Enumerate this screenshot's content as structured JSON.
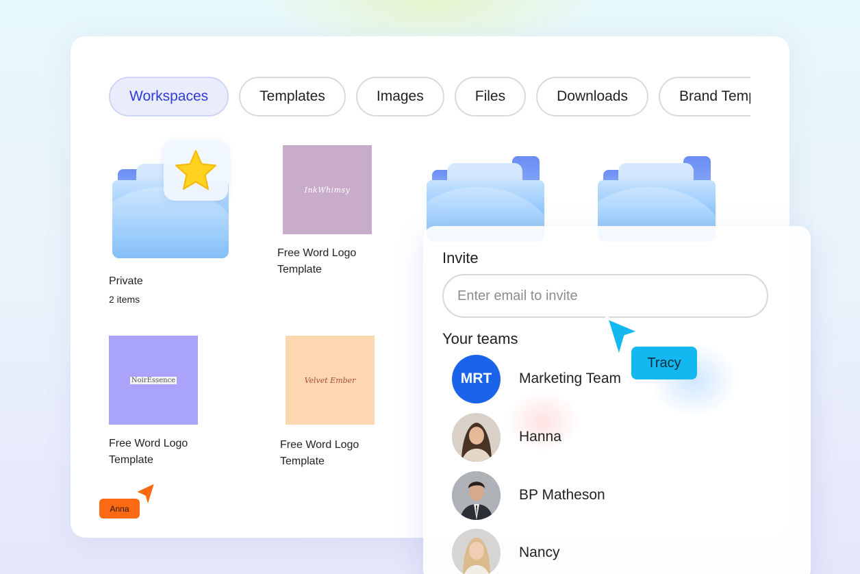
{
  "tabs": [
    {
      "label": "Workspaces",
      "active": true
    },
    {
      "label": "Templates",
      "active": false
    },
    {
      "label": "Images",
      "active": false
    },
    {
      "label": "Files",
      "active": false
    },
    {
      "label": "Downloads",
      "active": false
    },
    {
      "label": "Brand Templates",
      "active": false
    }
  ],
  "items": {
    "private_folder": {
      "name": "Private",
      "count": "2 items"
    },
    "template1": {
      "name_line1": "Free Word Logo",
      "name_line2": "Template",
      "thumb_text": "InkWhimsy",
      "thumb_color": "#c9acc9"
    },
    "template2": {
      "name_line1": "Free Word Logo",
      "name_line2": "Template",
      "thumb_text": "NoirEssence",
      "thumb_color": "#a9a4fa"
    },
    "template3": {
      "name_line1": "Free Word Logo",
      "name_line2": "Template",
      "thumb_text": "Velvet Ember",
      "thumb_color": "#fcd7b0"
    }
  },
  "invite": {
    "title": "Invite",
    "input_placeholder": "Enter email to invite",
    "teams_title": "Your teams",
    "teams": [
      {
        "initials": "MRT",
        "name": "Marketing Team",
        "avatar_color": "#1b63e9"
      },
      {
        "name": "Hanna"
      },
      {
        "name": "BP Matheson"
      },
      {
        "name": "Nancy"
      }
    ]
  },
  "cursors": {
    "tracy": {
      "label": "Tracy",
      "color": "#14b8f0"
    },
    "anna": {
      "label": "Anna",
      "color": "#fb6a12"
    }
  },
  "icons": {
    "star": "star-icon",
    "folder": "folder-icon",
    "cursor": "cursor-arrow-icon"
  }
}
